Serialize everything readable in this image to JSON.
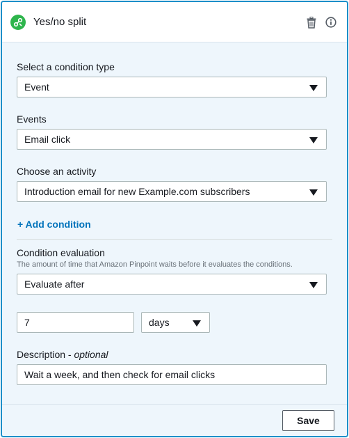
{
  "header": {
    "title": "Yes/no split",
    "node_icon": "yes-no-split-icon",
    "delete_icon": "trash-icon",
    "info_icon": "info-icon"
  },
  "condition_type": {
    "label": "Select a condition type",
    "value": "Event"
  },
  "events": {
    "label": "Events",
    "value": "Email click"
  },
  "activity": {
    "label": "Choose an activity",
    "value": "Introduction email for new Example.com subscribers"
  },
  "add_condition": {
    "label": "+ Add condition"
  },
  "evaluation": {
    "label": "Condition evaluation",
    "hint": "The amount of time that Amazon Pinpoint waits before it evaluates the conditions.",
    "value": "Evaluate after",
    "amount": "7",
    "unit": "days"
  },
  "description": {
    "label": "Description - ",
    "optional": "optional",
    "value": "Wait a week, and then check for email clicks"
  },
  "footer": {
    "save_label": "Save"
  },
  "colors": {
    "accent": "#1d8fc9",
    "node_green": "#2eb54c",
    "link": "#0073bb",
    "panel_bg": "#eef6fc"
  }
}
